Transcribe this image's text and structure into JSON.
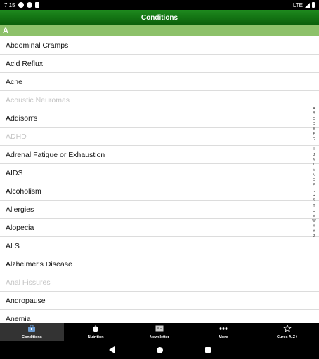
{
  "status_bar": {
    "time": "7:15",
    "network": "LTE"
  },
  "header": {
    "title": "Conditions"
  },
  "section": {
    "letter": "A"
  },
  "conditions": [
    {
      "label": "Abdominal Cramps",
      "enabled": true
    },
    {
      "label": "Acid Reflux",
      "enabled": true
    },
    {
      "label": "Acne",
      "enabled": true
    },
    {
      "label": "Acoustic Neuromas",
      "enabled": false
    },
    {
      "label": "Addison's",
      "enabled": true
    },
    {
      "label": "ADHD",
      "enabled": false
    },
    {
      "label": "Adrenal Fatigue or Exhaustion",
      "enabled": true
    },
    {
      "label": "AIDS",
      "enabled": true
    },
    {
      "label": "Alcoholism",
      "enabled": true
    },
    {
      "label": "Allergies",
      "enabled": true
    },
    {
      "label": "Alopecia",
      "enabled": true
    },
    {
      "label": "ALS",
      "enabled": true
    },
    {
      "label": "Alzheimer's Disease",
      "enabled": true
    },
    {
      "label": "Anal Fissures",
      "enabled": false
    },
    {
      "label": "Andropause",
      "enabled": true
    },
    {
      "label": "Anemia",
      "enabled": true
    }
  ],
  "index_letters": [
    "A",
    "B",
    "C",
    "D",
    "E",
    "F",
    "G",
    "H",
    "I",
    "J",
    "K",
    "L",
    "M",
    "N",
    "O",
    "P",
    "Q",
    "R",
    "S",
    "T",
    "U",
    "V",
    "W",
    "X",
    "Y",
    "Z"
  ],
  "tabs": [
    {
      "label": "Conditions",
      "icon": "briefcase-icon",
      "active": true
    },
    {
      "label": "Nutrition",
      "icon": "apple-icon",
      "active": false
    },
    {
      "label": "Newsletter",
      "icon": "newsletter-icon",
      "active": false
    },
    {
      "label": "More",
      "icon": "more-dots-icon",
      "active": false
    },
    {
      "label": "Cures A-Z+",
      "icon": "star-icon",
      "active": false
    }
  ],
  "colors": {
    "header_green": "#0a5e0a",
    "section_green": "#8dc16a",
    "disabled_text": "#c4c4c4"
  }
}
